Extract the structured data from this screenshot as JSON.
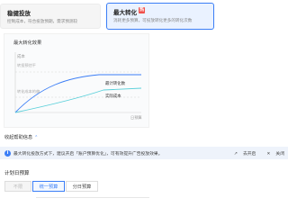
{
  "strategy_cards": {
    "stable": {
      "title": "稳健投放",
      "desc": "控制成本，符合投放预期，需求预测较"
    },
    "max": {
      "title": "最大转化",
      "hot_badge": "热",
      "desc": "消耗更多预算，可投放转化更多的转化次数"
    }
  },
  "chart": {
    "title": "最大转化效果",
    "y_axis_label": "成本",
    "guide_label_top": "转投预估平",
    "guide_label_mid": "转化成本的偏",
    "x_axis_label": "日预算",
    "line_labels": {
      "max": "最计转化数",
      "actual": "实际成本"
    },
    "colors": {
      "max_line": "#3b7ef6",
      "actual_line": "#5bd0da",
      "guide": "#d6d6d6"
    }
  },
  "collapse": {
    "label": "收起帮助信息",
    "icon": "chevron-up-icon"
  },
  "info_bar": {
    "icon": "info-icon",
    "text": "最大转化投放方式下，建议开启「账户预算优化」，可有效提升广告投放效果。",
    "go_open": "去开启",
    "close_label": "关闭"
  },
  "budget": {
    "label": "计划日预算",
    "options": [
      "不限",
      "统一预算",
      "分日预算"
    ],
    "selected": "统一预算"
  }
}
